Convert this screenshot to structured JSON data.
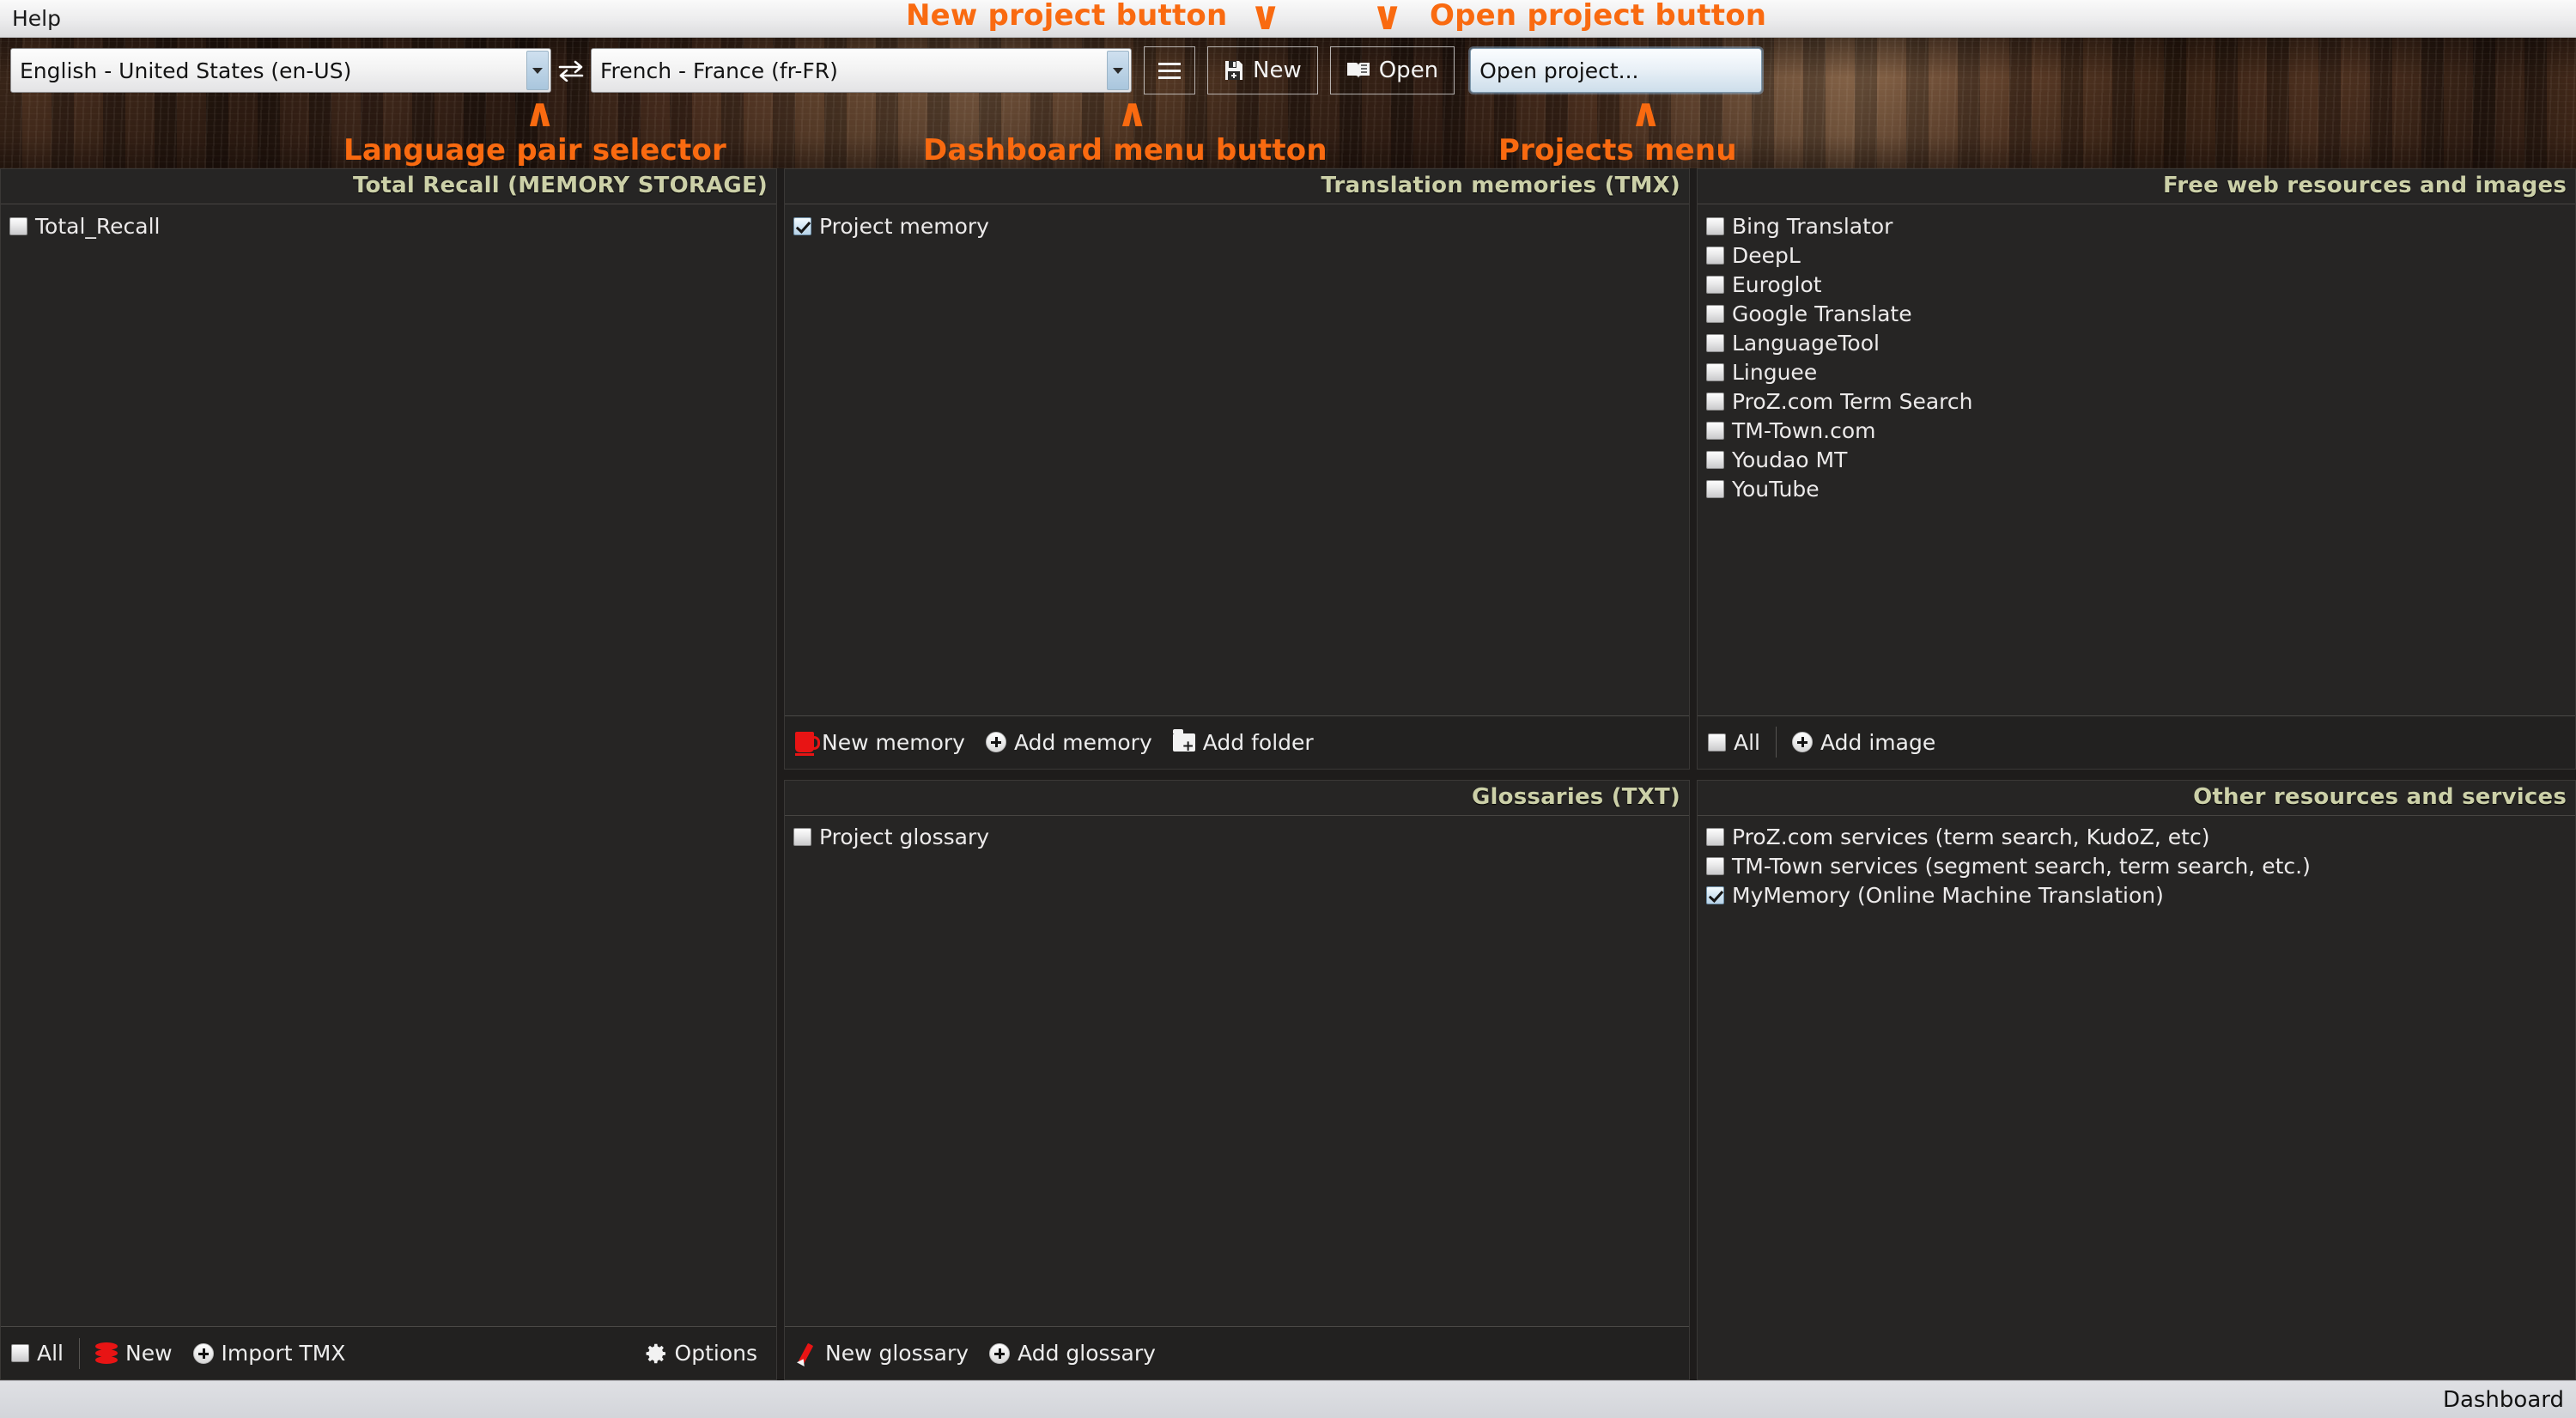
{
  "menubar": {
    "items": [
      "Help"
    ]
  },
  "toolbar": {
    "source_language": "English - United States (en-US)",
    "target_language": "French - France (fr-FR)",
    "swap_icon": "swap-arrows-icon",
    "dashboard_menu_label": "",
    "new_label": "New",
    "open_label": "Open",
    "projects_menu_value": "Open project..."
  },
  "annotations": [
    {
      "text": "New project button",
      "caret": "down"
    },
    {
      "text": "Open project button",
      "caret": "down"
    },
    {
      "text": "Language pair selector",
      "caret": "up"
    },
    {
      "text": "Dashboard menu button",
      "caret": "up"
    },
    {
      "text": "Projects menu",
      "caret": "up"
    },
    {
      "accent_color": "#f96a10"
    }
  ],
  "panels": {
    "total_recall": {
      "title": "Total Recall (MEMORY STORAGE)",
      "items": [
        {
          "label": "Total_Recall",
          "checked": false
        }
      ],
      "footer": {
        "all_label": "All",
        "new_label": "New",
        "import_label": "Import TMX",
        "options_label": "Options",
        "all_checked": false
      }
    },
    "translation_memories": {
      "title": "Translation memories (TMX)",
      "items": [
        {
          "label": "Project memory",
          "checked": true
        }
      ],
      "footer": {
        "new_memory_label": "New memory",
        "add_memory_label": "Add memory",
        "add_folder_label": "Add folder"
      }
    },
    "glossaries": {
      "title": "Glossaries (TXT)",
      "items": [
        {
          "label": "Project glossary",
          "checked": false
        }
      ],
      "footer": {
        "new_glossary_label": "New glossary",
        "add_glossary_label": "Add glossary"
      }
    },
    "web_resources": {
      "title": "Free web resources and images",
      "items": [
        {
          "label": "Bing Translator",
          "checked": false
        },
        {
          "label": "DeepL",
          "checked": false
        },
        {
          "label": "Euroglot",
          "checked": false
        },
        {
          "label": "Google Translate",
          "checked": false
        },
        {
          "label": "LanguageTool",
          "checked": false
        },
        {
          "label": "Linguee",
          "checked": false
        },
        {
          "label": "ProZ.com Term Search",
          "checked": false
        },
        {
          "label": "TM-Town.com",
          "checked": false
        },
        {
          "label": "Youdao MT",
          "checked": false
        },
        {
          "label": "YouTube",
          "checked": false
        }
      ],
      "footer": {
        "all_label": "All",
        "all_checked": false,
        "add_image_label": "Add image"
      }
    },
    "other_resources": {
      "title": "Other resources and services",
      "items": [
        {
          "label": "ProZ.com services (term search, KudoZ, etc)",
          "checked": false
        },
        {
          "label": "TM-Town services (segment search, term search, etc.)",
          "checked": false
        },
        {
          "label": "MyMemory (Online Machine Translation)",
          "checked": true
        }
      ]
    }
  },
  "statusbar": {
    "text": "Dashboard"
  },
  "colors": {
    "accent_orange": "#f96a10",
    "panel_title": "#ccd0a8",
    "panel_bg": "#262524",
    "app_bg": "#1e1c1b",
    "icon_red": "#e81414"
  }
}
